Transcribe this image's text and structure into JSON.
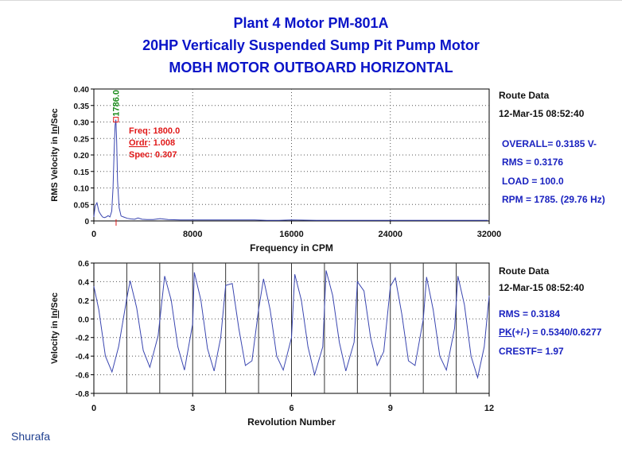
{
  "header": {
    "title_line1": "Plant 4 Motor PM-801A",
    "title_line2": "20HP Vertically Suspended Sump Pit Pump Motor",
    "title_line3": "MOBH   MOTOR OUTBOARD HORIZONTAL"
  },
  "spectrum_panel": {
    "route_label": "Route Data",
    "timestamp": "12-Mar-15  08:52:40",
    "overall": "OVERALL= 0.3185 V-",
    "rms": "RMS =  0.3176",
    "load": "LOAD = 100.0",
    "rpm": "RPM = 1785. (29.76 Hz)"
  },
  "waveform_panel": {
    "route_label": "Route Data",
    "timestamp": "12-Mar-15  08:52:40",
    "rms": "RMS =  0.3184",
    "pk_label": "PK",
    "pk_value": "(+/-) = 0.5340/0.6277",
    "crest": "CRESTF= 1.97"
  },
  "footer": {
    "signature": "Shurafa"
  },
  "colors": {
    "title": "#0a14c8",
    "trace": "#3a46b0",
    "marker_text": "#e01818",
    "peak_label": "#1a8a1a"
  },
  "chart_data": [
    {
      "type": "line",
      "xlabel": "Frequency in CPM",
      "ylabel_parts": [
        "RMS Velocity in ",
        "In",
        "/Sec"
      ],
      "xlim": [
        0,
        32000
      ],
      "ylim": [
        0,
        0.4
      ],
      "x_ticks": [
        0,
        8000,
        16000,
        24000,
        32000
      ],
      "x_tick_labels": [
        "0",
        "8000",
        "16000",
        "24000",
        "32000"
      ],
      "y_ticks": [
        0,
        0.05,
        0.1,
        0.15,
        0.2,
        0.25,
        0.3,
        0.35,
        0.4
      ],
      "y_tick_labels": [
        "0",
        "0.05",
        "0.10",
        "0.15",
        "0.20",
        "0.25",
        "0.30",
        "0.35",
        "0.40"
      ],
      "grid": "dotted",
      "peak_label": "1786.0",
      "marker": {
        "freq": "Freq: 1800.0",
        "ordr_label": "Ordr",
        "ordr_value": ": 1.008",
        "spec": "Spec:  0.307"
      },
      "series": [
        {
          "x": [
            0,
            100,
            250,
            400,
            550,
            700,
            850,
            1000,
            1150,
            1300,
            1450,
            1550,
            1650,
            1720,
            1786,
            1850,
            1920,
            2050,
            2200,
            2400,
            2700,
            3000,
            3300,
            3571,
            3900,
            4300,
            4800,
            5357,
            6000,
            7000,
            8000,
            9000,
            10000,
            11000,
            12000,
            13000,
            14000,
            15000,
            16000,
            18000,
            20000,
            22000,
            24000,
            26000,
            28000,
            30000,
            31900
          ],
          "y": [
            0.012,
            0.045,
            0.055,
            0.03,
            0.02,
            0.012,
            0.01,
            0.012,
            0.016,
            0.012,
            0.03,
            0.1,
            0.22,
            0.29,
            0.307,
            0.24,
            0.12,
            0.04,
            0.015,
            0.012,
            0.008,
            0.006,
            0.005,
            0.009,
            0.005,
            0.004,
            0.004,
            0.007,
            0.004,
            0.003,
            0.003,
            0.003,
            0.003,
            0.003,
            0.003,
            0.003,
            0.002,
            0.002,
            0.003,
            0.002,
            0.002,
            0.002,
            0.002,
            0.002,
            0.002,
            0.002,
            0.002
          ]
        }
      ]
    },
    {
      "type": "line",
      "xlabel": "Revolution Number",
      "ylabel_parts": [
        "Velocity in ",
        "In",
        "/Sec"
      ],
      "xlim": [
        0,
        12
      ],
      "ylim": [
        -0.8,
        0.6
      ],
      "x_ticks": [
        0,
        3,
        6,
        9,
        12
      ],
      "x_tick_labels": [
        "0",
        "3",
        "6",
        "9",
        "12"
      ],
      "y_ticks": [
        -0.8,
        -0.6,
        -0.4,
        -0.2,
        0,
        0.2,
        0.4,
        0.6
      ],
      "y_tick_labels": [
        "-0.8",
        "-0.6",
        "-0.4",
        "-0.2",
        "0.0",
        "0.2",
        "0.4",
        "0.6"
      ],
      "revolution_lines": [
        1,
        2,
        3,
        4,
        5,
        6,
        7,
        8,
        9,
        10,
        11
      ],
      "series": [
        {
          "x": [
            0,
            0.15,
            0.35,
            0.55,
            0.75,
            1.0,
            1.1,
            1.3,
            1.5,
            1.7,
            1.95,
            2.15,
            2.35,
            2.55,
            2.75,
            3.0,
            3.05,
            3.25,
            3.45,
            3.65,
            3.85,
            4.0,
            4.2,
            4.4,
            4.6,
            4.8,
            5.0,
            5.15,
            5.35,
            5.55,
            5.75,
            6.0,
            6.1,
            6.3,
            6.5,
            6.7,
            6.95,
            7.05,
            7.25,
            7.45,
            7.65,
            7.9,
            8.0,
            8.2,
            8.4,
            8.6,
            8.8,
            9.0,
            9.15,
            9.35,
            9.55,
            9.75,
            10.0,
            10.1,
            10.3,
            10.5,
            10.7,
            10.95,
            11.05,
            11.25,
            11.45,
            11.65,
            11.85,
            12.0
          ],
          "y": [
            0.35,
            0.1,
            -0.4,
            -0.57,
            -0.3,
            0.22,
            0.41,
            0.12,
            -0.34,
            -0.52,
            -0.18,
            0.46,
            0.2,
            -0.3,
            -0.55,
            -0.05,
            0.5,
            0.2,
            -0.32,
            -0.56,
            -0.2,
            0.36,
            0.38,
            -0.1,
            -0.5,
            -0.45,
            0.1,
            0.43,
            0.1,
            -0.4,
            -0.55,
            -0.2,
            0.48,
            0.2,
            -0.3,
            -0.6,
            -0.3,
            0.52,
            0.25,
            -0.25,
            -0.56,
            -0.25,
            0.4,
            0.3,
            -0.2,
            -0.5,
            -0.35,
            0.35,
            0.44,
            0.05,
            -0.45,
            -0.5,
            0.0,
            0.45,
            0.1,
            -0.4,
            -0.55,
            -0.1,
            0.46,
            0.15,
            -0.4,
            -0.63,
            -0.3,
            0.25
          ]
        }
      ]
    }
  ]
}
